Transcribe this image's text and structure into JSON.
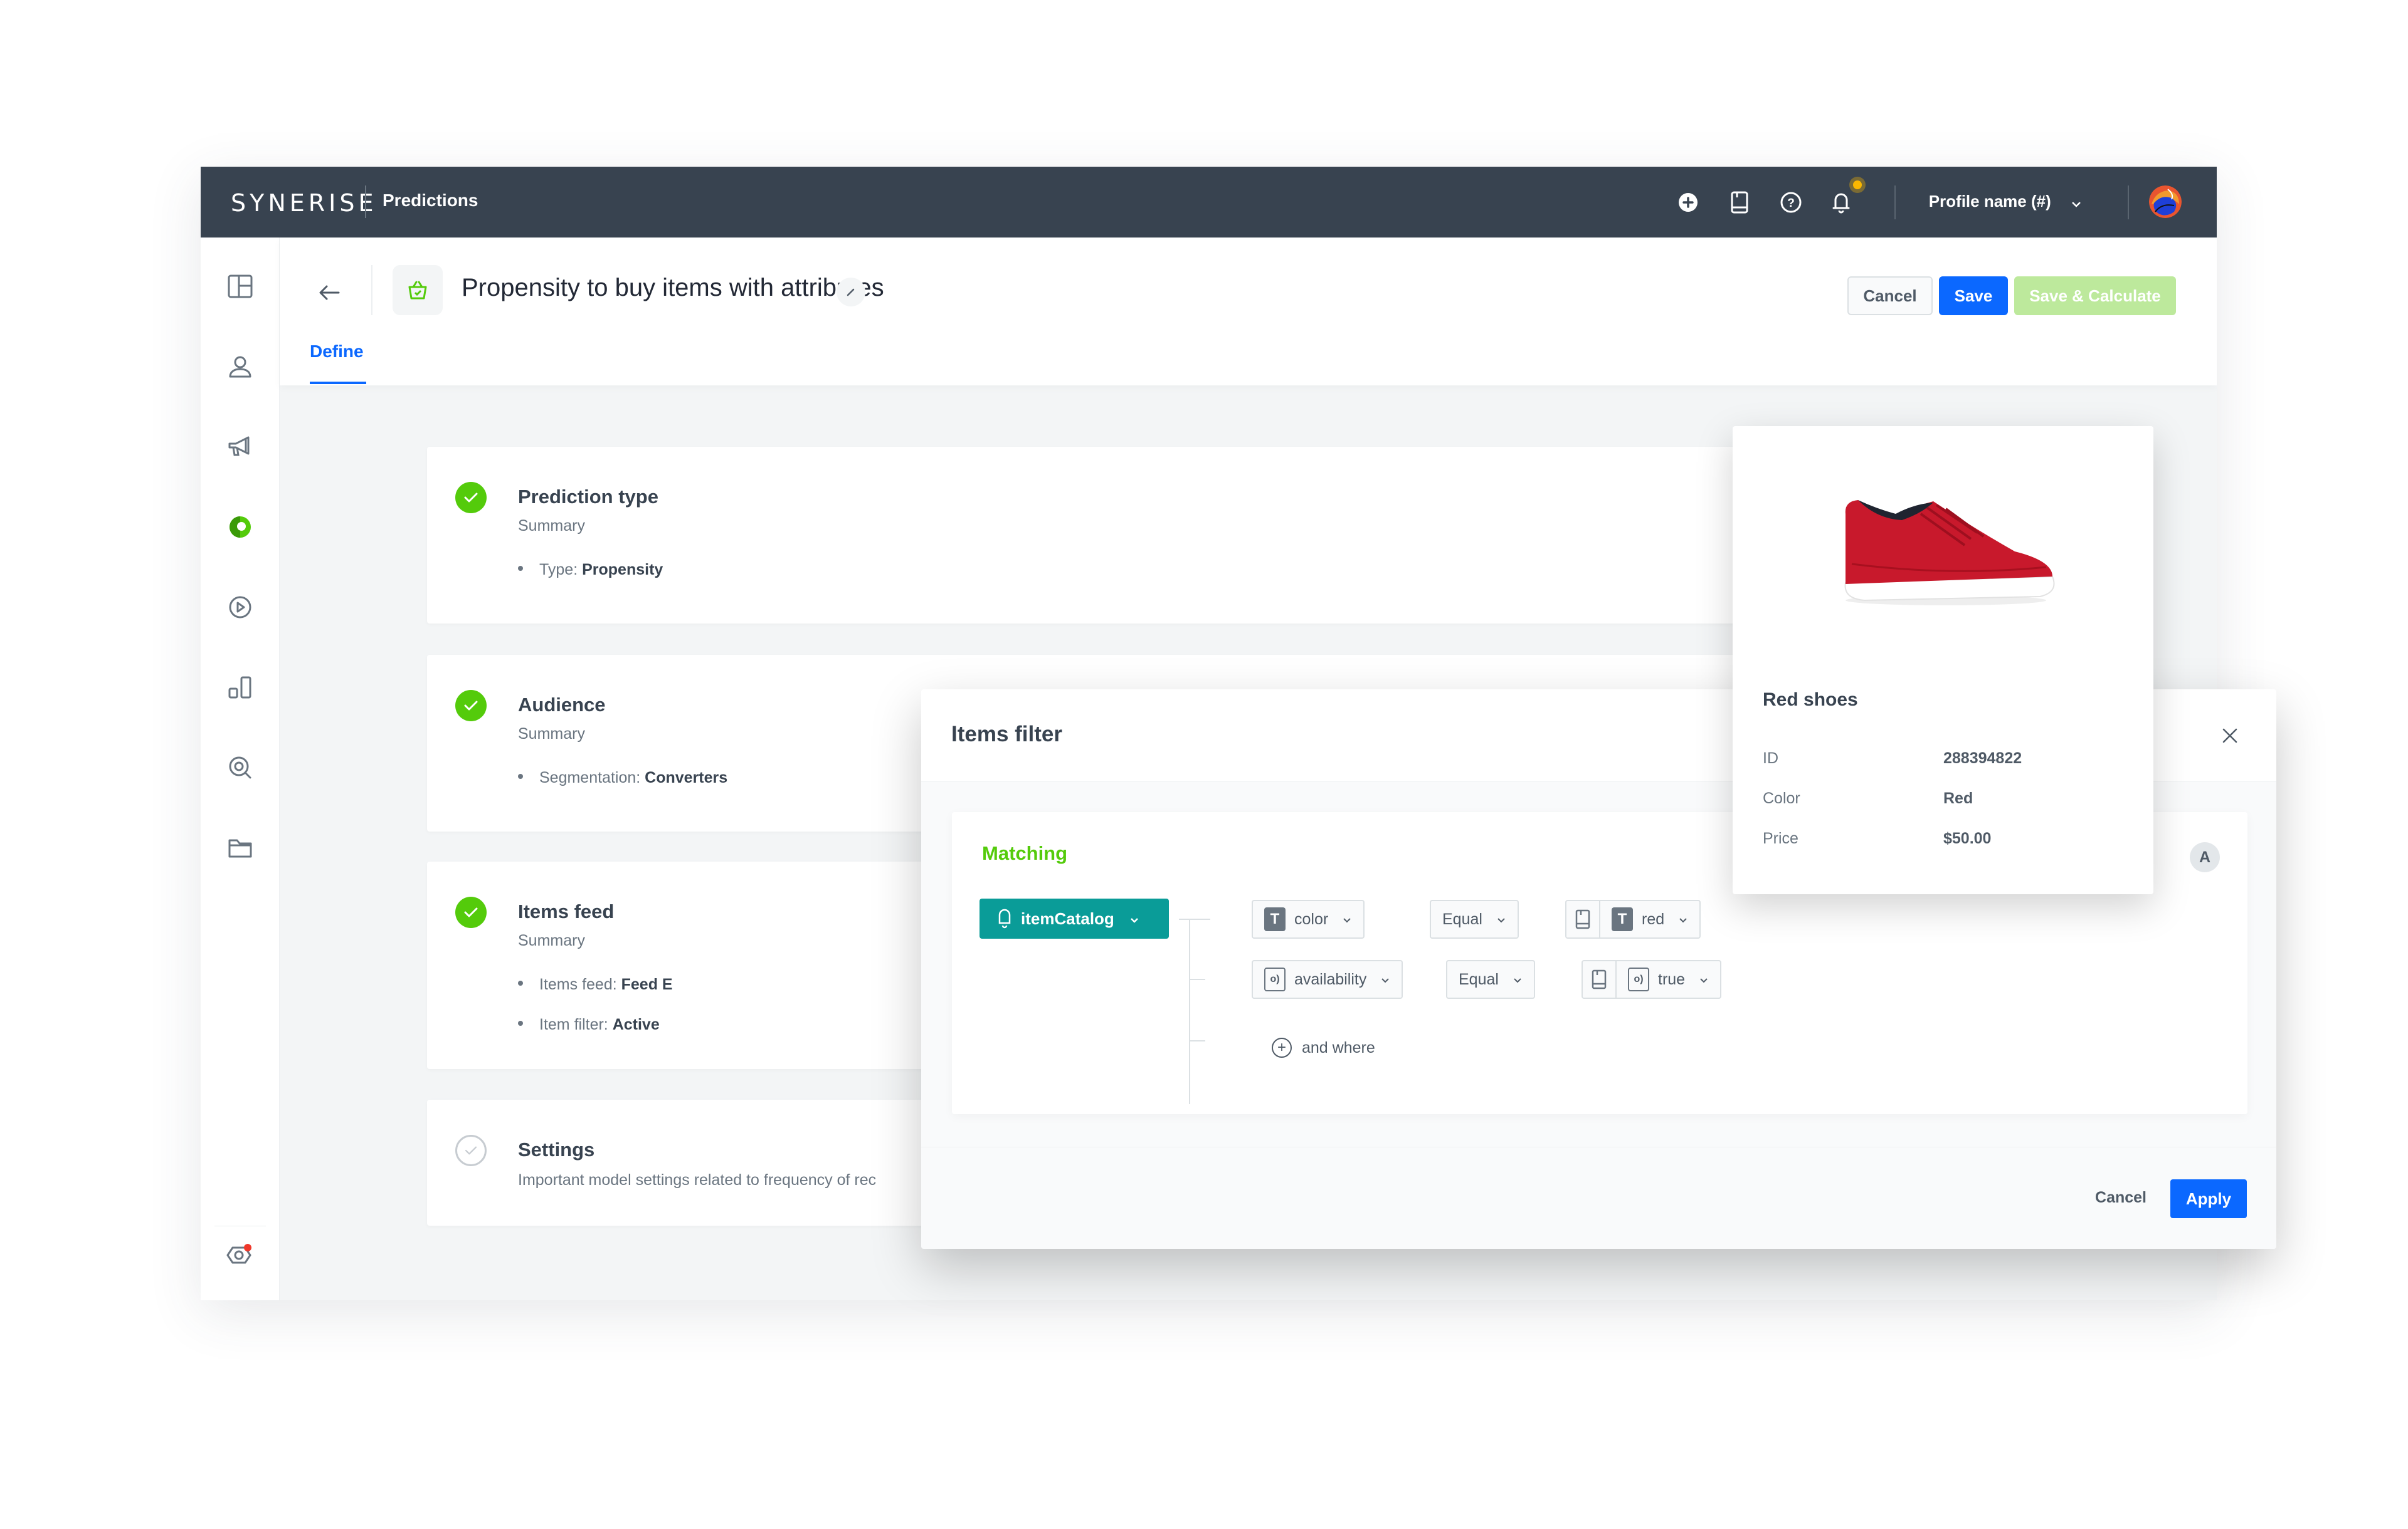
{
  "app": {
    "brand": "SYNERISE",
    "module": "Predictions"
  },
  "topbar": {
    "icons": [
      "add-circle-icon",
      "book-icon",
      "help-icon",
      "bell-icon"
    ],
    "notification_dot_color": "#fab700",
    "profile_label": "Profile name (#)"
  },
  "sidebar": {
    "items": [
      {
        "name": "dashboard-icon"
      },
      {
        "name": "profiles-icon"
      },
      {
        "name": "campaigns-icon"
      },
      {
        "name": "ai-predictions-icon",
        "active": true
      },
      {
        "name": "automation-icon"
      },
      {
        "name": "analytics-icon"
      },
      {
        "name": "search-icon"
      },
      {
        "name": "assets-folder-icon"
      }
    ],
    "footer_item": "settings-icon"
  },
  "page": {
    "title": "Propensity to buy items with attributes",
    "tabs": [
      "Define"
    ],
    "active_tab": "Define",
    "buttons": {
      "cancel": "Cancel",
      "save": "Save",
      "save_calculate": "Save & Calculate"
    }
  },
  "steps": [
    {
      "title": "Prediction type",
      "subtitle": "Summary",
      "status": "done",
      "items": [
        {
          "label": "Type:",
          "value": "Propensity"
        }
      ]
    },
    {
      "title": "Audience",
      "subtitle": "Summary",
      "status": "done",
      "items": [
        {
          "label": "Segmentation:",
          "value": "Converters"
        }
      ]
    },
    {
      "title": "Items feed",
      "subtitle": "Summary",
      "status": "done",
      "items": [
        {
          "label": "Items feed:",
          "value": "Feed E"
        },
        {
          "label": "Item filter:",
          "value": "Active"
        }
      ]
    },
    {
      "title": "Settings",
      "subtitle": "Important model settings related to frequency of rec",
      "status": "todo",
      "items": []
    }
  ],
  "modal": {
    "title": "Items filter",
    "section_label": "Matching",
    "avatar_letter": "A",
    "catalog": "itemCatalog",
    "conditions": [
      {
        "attribute": "color",
        "attribute_type": "T",
        "operator": "Equal",
        "value": "red",
        "value_type": "T"
      },
      {
        "attribute": "availability",
        "attribute_type": "bool",
        "operator": "Equal",
        "value": "true",
        "value_type": "bool"
      }
    ],
    "add_condition": "and where",
    "footer": {
      "cancel": "Cancel",
      "apply": "Apply"
    }
  },
  "product": {
    "name": "Red shoes",
    "fields": [
      {
        "key": "ID",
        "value": "288394822"
      },
      {
        "key": "Color",
        "value": "Red"
      },
      {
        "key": "Price",
        "value": "$50.00"
      }
    ]
  }
}
